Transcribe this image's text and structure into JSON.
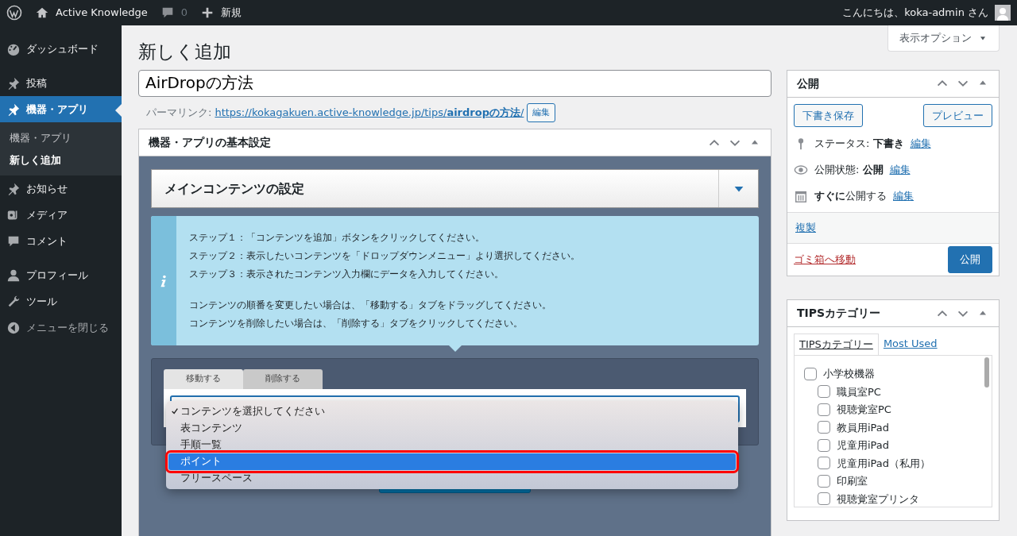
{
  "admin_bar": {
    "site_name": "Active Knowledge",
    "comments": "0",
    "new": "新規",
    "greeting": "こんにちは、koka-admin さん"
  },
  "sidebar": {
    "items": [
      {
        "label": "ダッシュボード",
        "selected": false
      },
      {
        "label": "投稿",
        "selected": false
      },
      {
        "label": "機器・アプリ",
        "selected": true,
        "children": [
          {
            "label": "機器・アプリ",
            "selected": false
          },
          {
            "label": "新しく追加",
            "selected": true
          }
        ]
      },
      {
        "label": "お知らせ",
        "selected": false
      },
      {
        "label": "メディア",
        "selected": false
      },
      {
        "label": "コメント",
        "selected": false
      },
      {
        "label": "プロフィール",
        "selected": false
      },
      {
        "label": "ツール",
        "selected": false
      },
      {
        "label": "メニューを閉じる",
        "selected": false
      }
    ]
  },
  "screen_options": "表示オプション",
  "page_title": "新しく追加",
  "post_title": "AirDropの方法",
  "permalink": {
    "label": "パーマリンク:",
    "url": "https://kokagakuen.active-knowledge.jp/tips/**airdropの方法**/",
    "edit": "編集"
  },
  "metabox": {
    "title": "機器・アプリの基本設定",
    "section_title": "メインコンテンツの設定",
    "info_paragraphs": [
      [
        "ステップ１：「コンテンツを追加」ボタンをクリックしてください。",
        "ステップ２：表示したいコンテンツを「ドロップダウンメニュー」より選択してください。",
        "ステップ３：表示されたコンテンツ入力欄にデータを入力してください。"
      ],
      [
        "コンテンツの順番を変更したい場合は、「移動する」タブをドラッグしてください。",
        "コンテンツを削除したい場合は、「削除する」タブをクリックしてください。"
      ]
    ],
    "tabs": [
      {
        "label": "移動する",
        "selected": true
      },
      {
        "label": "削除する",
        "selected": false
      }
    ],
    "dropdown": {
      "options": [
        {
          "label": "コンテンツを選択してください",
          "checked": true,
          "selected": false,
          "highlighted": false
        },
        {
          "label": "表コンテンツ",
          "checked": false,
          "selected": false,
          "highlighted": false
        },
        {
          "label": "手順一覧",
          "checked": false,
          "selected": false,
          "highlighted": false
        },
        {
          "label": "ポイント",
          "checked": false,
          "selected": true,
          "highlighted": true
        },
        {
          "label": "フリースペース",
          "checked": false,
          "selected": false,
          "highlighted": false
        }
      ]
    }
  },
  "publish": {
    "title": "公開",
    "save_draft": "下書き保存",
    "preview": "プレビュー",
    "meta": [
      {
        "text": "ステータス: **下書き**",
        "edit": "編集"
      },
      {
        "text": "公開状態: **公開**",
        "edit": "編集"
      },
      {
        "text": "**すぐに**公開する",
        "edit": "編集"
      }
    ],
    "duplicate": "複製",
    "trash": "ゴミ箱へ移動",
    "publish_button": "公開"
  },
  "categories": {
    "title": "TIPSカテゴリー",
    "tabs": [
      {
        "label": "TIPSカテゴリー",
        "selected": true
      },
      {
        "label": "Most Used",
        "selected": false
      }
    ],
    "items": [
      {
        "label": "小学校機器",
        "checked": false,
        "children": [
          {
            "label": "職員室PC",
            "checked": false
          },
          {
            "label": "視聴覚室PC",
            "checked": false
          },
          {
            "label": "教員用iPad",
            "checked": false
          },
          {
            "label": "児童用iPad",
            "checked": false
          },
          {
            "label": "児童用iPad（私用）",
            "checked": false
          },
          {
            "label": "印刷室",
            "checked": false
          },
          {
            "label": "視聴覚室プリンタ",
            "checked": false
          }
        ]
      }
    ]
  }
}
